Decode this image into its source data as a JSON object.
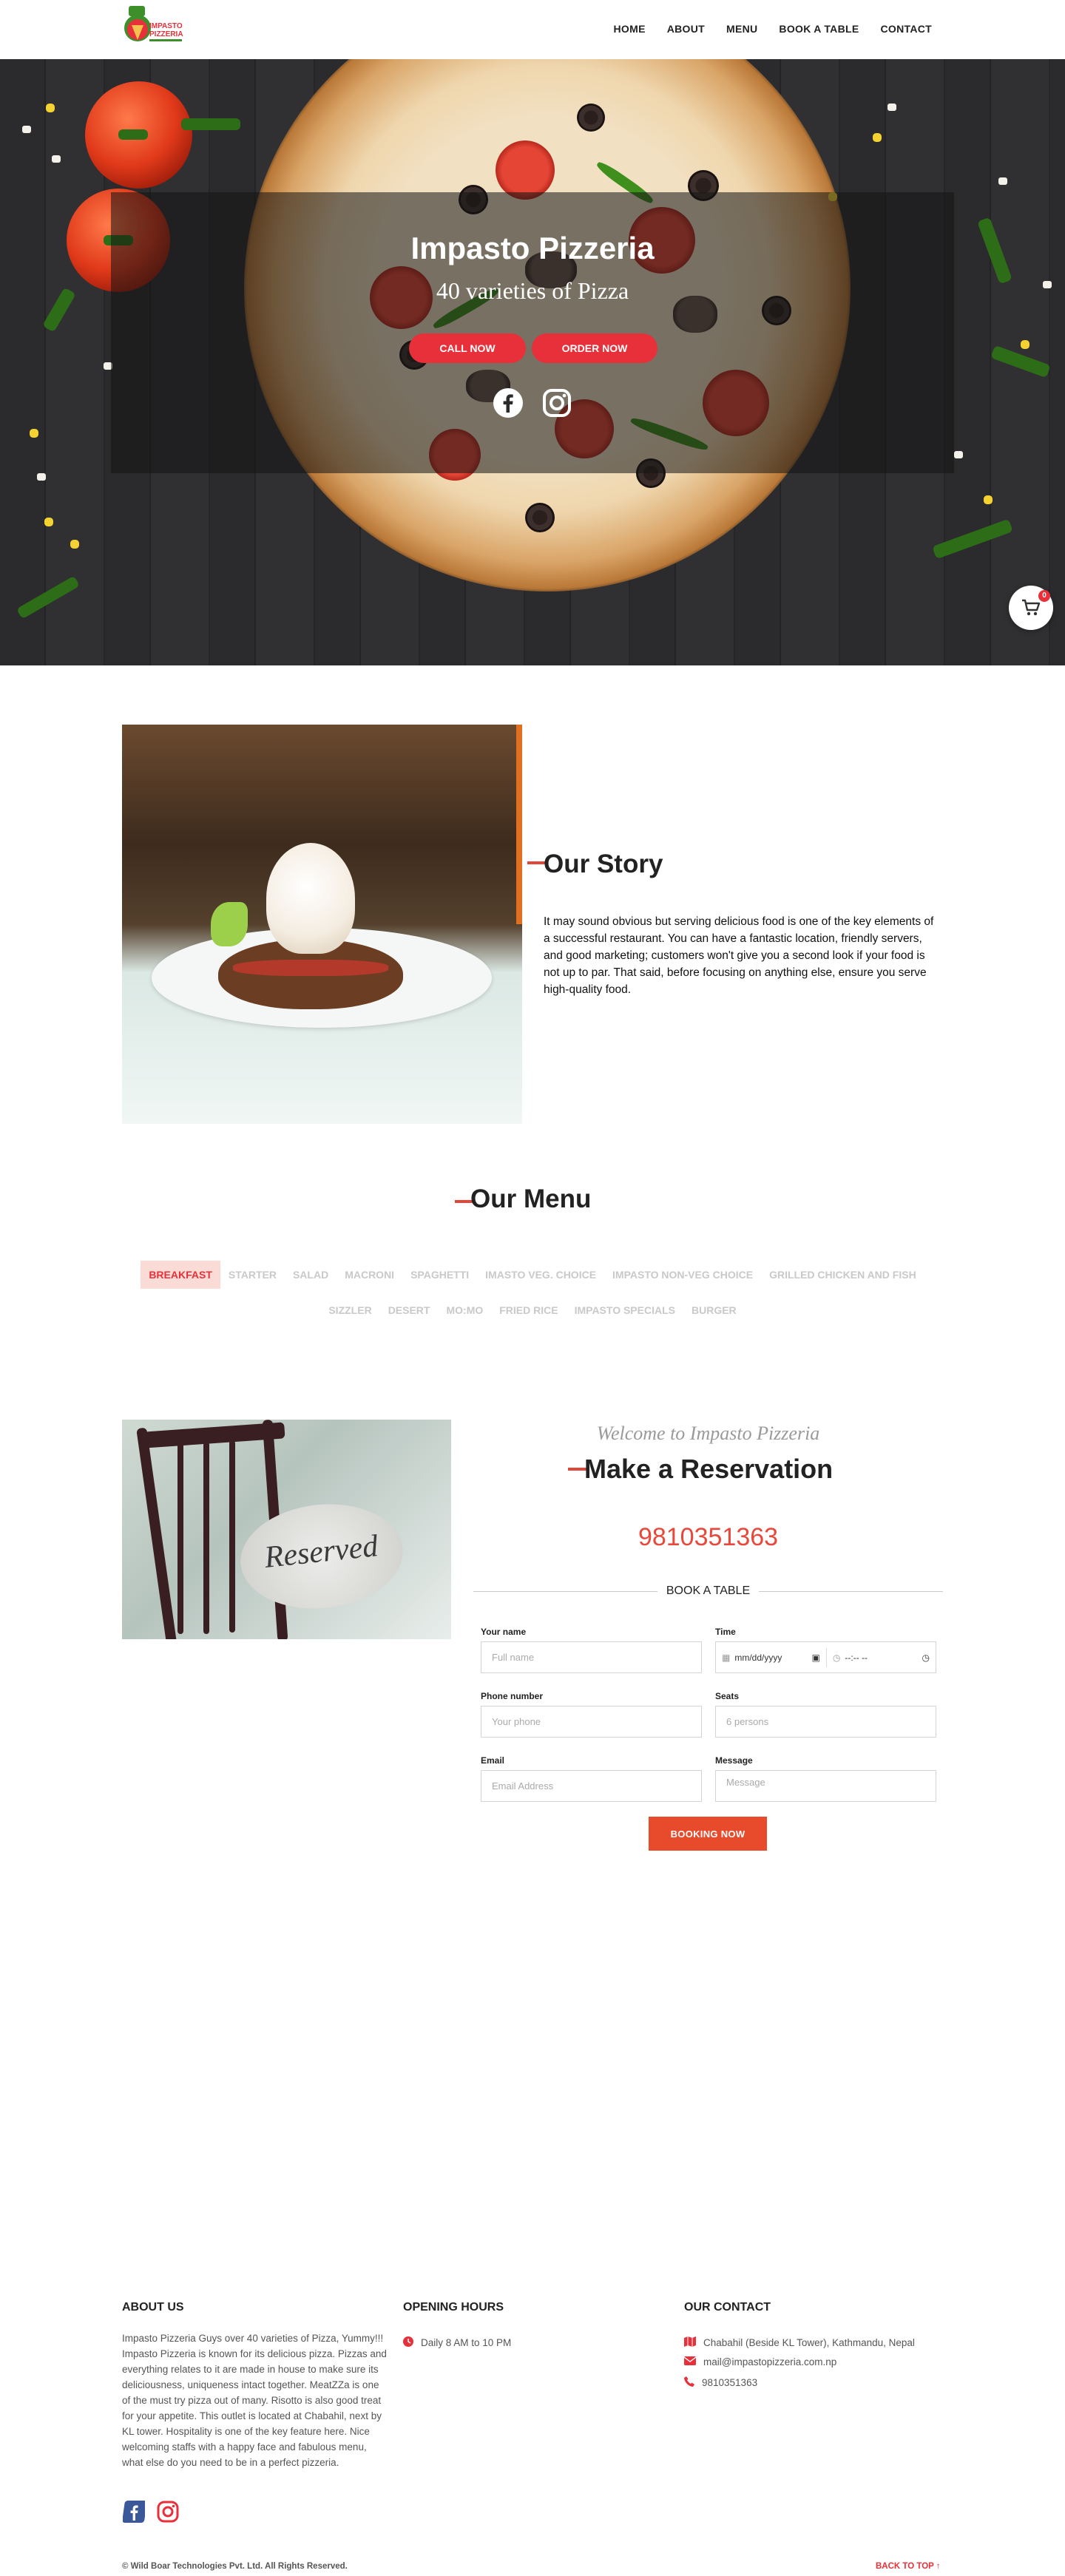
{
  "brand": {
    "name": "Impasto Pizzeria",
    "logo_text": "IMPASTO PIZZERIA",
    "accent": "#e8303a"
  },
  "nav": {
    "items": [
      "HOME",
      "ABOUT",
      "MENU",
      "BOOK A TABLE",
      "CONTACT"
    ]
  },
  "hero": {
    "title": "Impasto Pizzeria",
    "subtitle": "40 varieties of Pizza",
    "call_label": "CALL NOW",
    "order_label": "ORDER NOW",
    "social_icons": [
      "facebook-icon",
      "instagram-icon"
    ]
  },
  "cart": {
    "count": "0"
  },
  "story": {
    "title": "Our Story",
    "text": "It may sound obvious but serving delicious food is one of the key elements of a successful restaurant. You can have a fantastic location, friendly servers, and good marketing; customers won't give you a second look if your food is not up to par. That said, before focusing on anything else, ensure you serve high-quality food."
  },
  "menu": {
    "title": "Our Menu",
    "active": "BREAKFAST",
    "categories": [
      "BREAKFAST",
      "STARTER",
      "SALAD",
      "MACRONI",
      "SPAGHETTI",
      "IMASTO VEG. CHOICE",
      "IMPASTO NON-VEG CHOICE",
      "GRILLED CHICKEN AND FISH",
      "SIZZLER",
      "DESERT",
      "MO:MO",
      "FRIED RICE",
      "IMPASTO SPECIALS",
      "BURGER"
    ]
  },
  "reservation": {
    "sign_text": "Reserved",
    "welcome": "Welcome to Impasto Pizzeria",
    "title": "Make a Reservation",
    "phone": "9810351363",
    "form_heading": "BOOK A TABLE",
    "fields": {
      "name": {
        "label": "Your name",
        "placeholder": "Full name"
      },
      "time": {
        "label": "Time",
        "date_placeholder": "mm/dd/yyyy",
        "time_placeholder": "--:-- --"
      },
      "phone": {
        "label": "Phone number",
        "placeholder": "Your phone"
      },
      "seats": {
        "label": "Seats",
        "placeholder": "6 persons"
      },
      "email": {
        "label": "Email",
        "placeholder": "Email Address"
      },
      "message": {
        "label": "Message",
        "placeholder": "Message"
      }
    },
    "submit_label": "BOOKING NOW"
  },
  "footer": {
    "about_title": "ABOUT US",
    "about_text": "Impasto Pizzeria Guys over 40 varieties of Pizza, Yummy!!! Impasto Pizzeria is known for its delicious pizza. Pizzas and everything relates to it are made in house to make sure its deliciousness, uniqueness intact together. MeatZZa is one of the must try pizza out of many. Risotto is also good treat for your appetite. This outlet is located at Chabahil, next by KL tower. Hospitality is one of the key feature here. Nice welcoming staffs with a happy face and fabulous menu, what else do you need to be in a perfect pizzeria.",
    "hours_title": "OPENING HOURS",
    "hours": "Daily 8 AM to 10 PM",
    "contact_title": "OUR CONTACT",
    "address": "Chabahil (Beside KL Tower), Kathmandu, Nepal",
    "email": "mail@impastopizzeria.com.np",
    "phone": "9810351363",
    "copyright": "© Wild Boar Technologies Pvt. Ltd. All Rights Reserved.",
    "back_to_top": "BACK TO TOP ↑",
    "colors": {
      "facebook": "#3b5998",
      "instagram": "#e8303a"
    }
  }
}
